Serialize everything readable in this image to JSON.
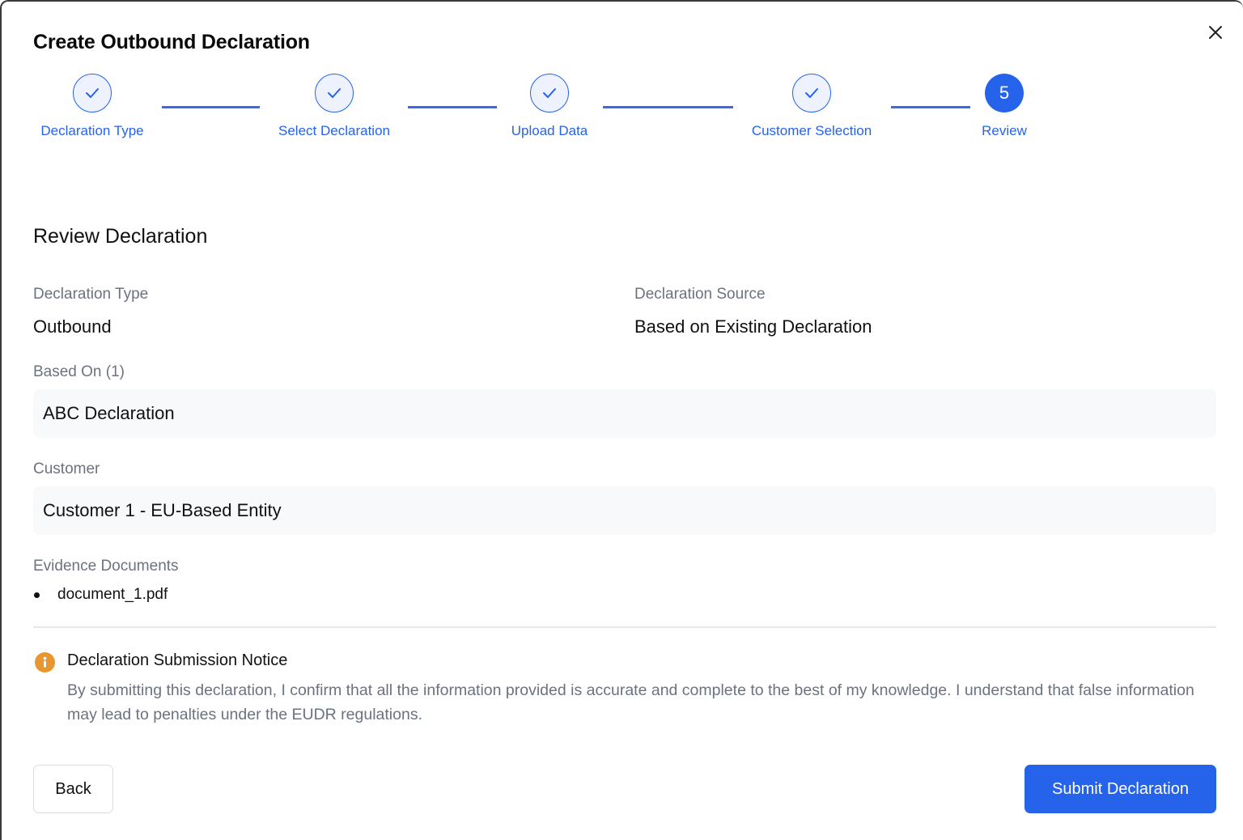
{
  "dialog": {
    "title": "Create Outbound Declaration",
    "close_icon": "close-icon"
  },
  "stepper": {
    "steps": [
      {
        "label": "Declaration Type",
        "status": "complete",
        "icon": "check-icon"
      },
      {
        "label": "Select Declaration",
        "status": "complete",
        "icon": "check-icon"
      },
      {
        "label": "Upload Data",
        "status": "complete",
        "icon": "check-icon"
      },
      {
        "label": "Customer Selection",
        "status": "complete",
        "icon": "check-icon"
      },
      {
        "label": "Review",
        "status": "active",
        "number": "5"
      }
    ],
    "accent_color": "#2563eb"
  },
  "review": {
    "title": "Review Declaration",
    "declaration_type": {
      "label": "Declaration Type",
      "value": "Outbound"
    },
    "declaration_source": {
      "label": "Declaration Source",
      "value": "Based on Existing Declaration"
    },
    "based_on": {
      "label": "Based On (1)",
      "value": "ABC Declaration"
    },
    "customer": {
      "label": "Customer",
      "value": "Customer 1 - EU-Based Entity"
    },
    "evidence": {
      "label": "Evidence Documents",
      "documents": [
        "document_1.pdf"
      ]
    }
  },
  "notice": {
    "icon": "info-icon",
    "icon_color": "#e8962f",
    "title": "Declaration Submission Notice",
    "text": "By submitting this declaration, I confirm that all the information provided is accurate and complete to the best of my knowledge. I understand that false information may lead to penalties under the EUDR regulations."
  },
  "actions": {
    "back_label": "Back",
    "submit_label": "Submit Declaration"
  }
}
